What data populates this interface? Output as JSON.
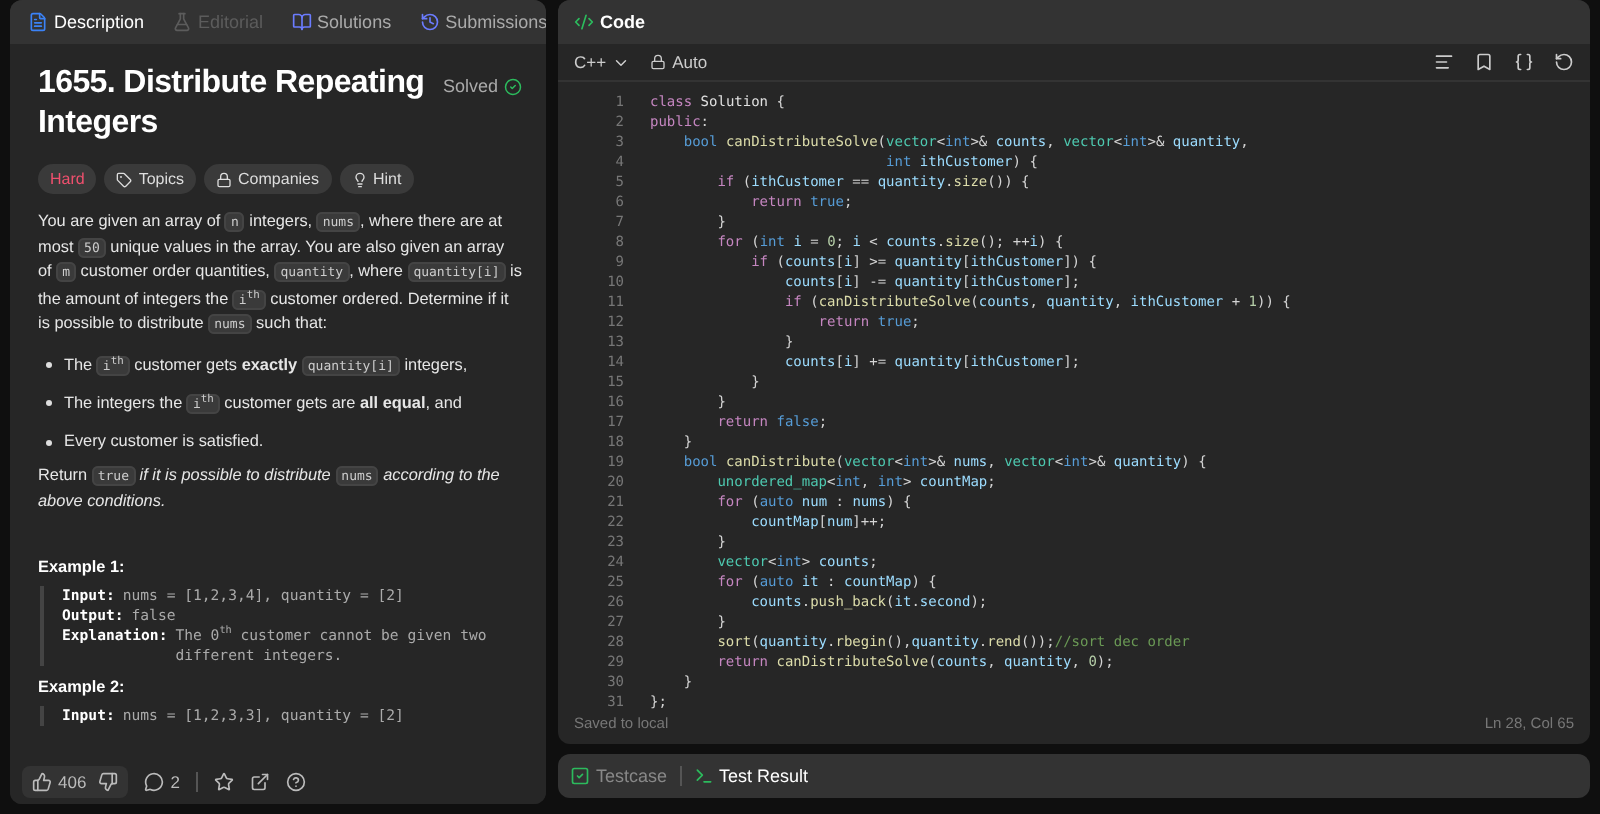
{
  "tabs": [
    {
      "label": "Description",
      "selected": true,
      "disabled": false
    },
    {
      "label": "Editorial",
      "selected": false,
      "disabled": true
    },
    {
      "label": "Solutions",
      "selected": false,
      "disabled": false
    },
    {
      "label": "Submissions",
      "selected": false,
      "disabled": false
    }
  ],
  "problem": {
    "title": "1655. Distribute Repeating Integers",
    "status": "Solved",
    "difficulty": "Hard",
    "tags": [
      {
        "label": "Topics",
        "kind": "tag"
      },
      {
        "label": "Companies",
        "kind": "lock"
      },
      {
        "label": "Hint",
        "kind": "bulb"
      }
    ],
    "paragraphs": [
      {
        "kind": "para",
        "segments": [
          {
            "kind": "text",
            "text": "You are given an array of "
          },
          {
            "kind": "code",
            "text": "n"
          },
          {
            "kind": "text",
            "text": " integers, "
          },
          {
            "kind": "code",
            "text": "nums"
          },
          {
            "kind": "text",
            "text": ", where there are at most "
          },
          {
            "kind": "code",
            "text": "50"
          },
          {
            "kind": "text",
            "text": " unique values in the array. You are also given an array of "
          },
          {
            "kind": "code",
            "text": "m"
          },
          {
            "kind": "text",
            "text": " customer order quantities, "
          },
          {
            "kind": "code",
            "text": "quantity"
          },
          {
            "kind": "text",
            "text": ", where "
          },
          {
            "kind": "code",
            "text": "quantity[i]"
          },
          {
            "kind": "text",
            "text": " is the amount of integers the "
          },
          {
            "kind": "code",
            "text": "i$^{th}$"
          },
          {
            "kind": "text",
            "text": " customer ordered. Determine if it is possible to distribute "
          },
          {
            "kind": "code",
            "text": "nums"
          },
          {
            "kind": "text",
            "text": " such that:"
          }
        ]
      },
      {
        "kind": "bullet",
        "segments": [
          {
            "kind": "text",
            "text": "The "
          },
          {
            "kind": "code",
            "text": "i$^{th}$"
          },
          {
            "kind": "text",
            "text": " customer gets **exactly** "
          },
          {
            "kind": "code",
            "text": "quantity[i]"
          },
          {
            "kind": "text",
            "text": " integers,"
          }
        ]
      },
      {
        "kind": "bullet",
        "segments": [
          {
            "kind": "text",
            "text": "The integers the "
          },
          {
            "kind": "code",
            "text": "i$^{th}$"
          },
          {
            "kind": "text",
            "text": " customer gets are **all equal**, and"
          }
        ]
      },
      {
        "kind": "bullet",
        "segments": [
          {
            "kind": "text",
            "text": "Every customer is satisfied."
          }
        ]
      },
      {
        "kind": "para",
        "segments": [
          {
            "kind": "text",
            "text": "Return "
          },
          {
            "kind": "code",
            "text": "true"
          },
          {
            "kind": "text",
            "text": " *if it is possible to distribute* "
          },
          {
            "kind": "code",
            "text": "nums"
          },
          {
            "kind": "text",
            "text": " *according to the above conditions.*"
          }
        ]
      }
    ],
    "examples": [
      {
        "title": "Example 1:",
        "lines": [
          {
            "label": "Input:",
            "value": "nums = [1,2,3,4], quantity = [2]"
          },
          {
            "label": "Output:",
            "value": "false"
          },
          {
            "label": "Explanation:",
            "value": "The 0$^{th}$ customer cannot be given two different integers."
          }
        ]
      },
      {
        "title": "Example 2:",
        "lines": [
          {
            "label": "Input:",
            "value": "nums = [1,2,3,3], quantity = [2]"
          }
        ]
      }
    ]
  },
  "footer": {
    "likes": "406",
    "comments": "2"
  },
  "code_panel": {
    "title": "Code",
    "language": "C++",
    "mode": "Auto",
    "lines": [
      {
        "number": "1",
        "code": "class Solution {"
      },
      {
        "number": "2",
        "code": "public:"
      },
      {
        "number": "3",
        "code": "    bool canDistributeSolve(vector<int>& counts, vector<int>& quantity,"
      },
      {
        "number": "4",
        "code": "                            int ithCustomer) {"
      },
      {
        "number": "5",
        "code": "        if (ithCustomer == quantity.size()) {"
      },
      {
        "number": "6",
        "code": "            return true;"
      },
      {
        "number": "7",
        "code": "        }"
      },
      {
        "number": "8",
        "code": "        for (int i = 0; i < counts.size(); ++i) {"
      },
      {
        "number": "9",
        "code": "            if (counts[i] >= quantity[ithCustomer]) {"
      },
      {
        "number": "10",
        "code": "                counts[i] -= quantity[ithCustomer];"
      },
      {
        "number": "11",
        "code": "                if (canDistributeSolve(counts, quantity, ithCustomer + 1)) {"
      },
      {
        "number": "12",
        "code": "                    return true;"
      },
      {
        "number": "13",
        "code": "                }"
      },
      {
        "number": "14",
        "code": "                counts[i] += quantity[ithCustomer];"
      },
      {
        "number": "15",
        "code": "            }"
      },
      {
        "number": "16",
        "code": "        }"
      },
      {
        "number": "17",
        "code": "        return false;"
      },
      {
        "number": "18",
        "code": "    }"
      },
      {
        "number": "19",
        "code": "    bool canDistribute(vector<int>& nums, vector<int>& quantity) {"
      },
      {
        "number": "20",
        "code": "        unordered_map<int, int> countMap;"
      },
      {
        "number": "21",
        "code": "        for (auto num : nums) {"
      },
      {
        "number": "22",
        "code": "            countMap[num]++;"
      },
      {
        "number": "23",
        "code": "        }"
      },
      {
        "number": "24",
        "code": "        vector<int> counts;"
      },
      {
        "number": "25",
        "code": "        for (auto it : countMap) {"
      },
      {
        "number": "26",
        "code": "            counts.push_back(it.second);"
      },
      {
        "number": "27",
        "code": "        }"
      },
      {
        "number": "28",
        "code": "        sort(quantity.rbegin(),quantity.rend());//sort dec order"
      },
      {
        "number": "29",
        "code": "        return canDistributeSolve(counts, quantity, 0);"
      },
      {
        "number": "30",
        "code": "    }"
      },
      {
        "number": "31",
        "code": "};"
      }
    ],
    "saved": "Saved to local",
    "cursor": "Ln 28, Col 65"
  },
  "bottom_tabs": [
    {
      "label": "Testcase",
      "selected": false
    },
    {
      "label": "Test Result",
      "selected": true
    }
  ]
}
